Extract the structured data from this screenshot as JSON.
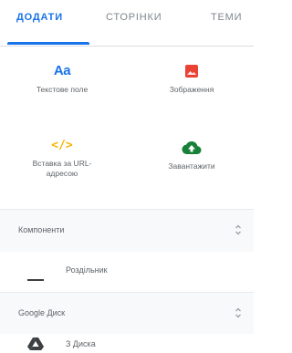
{
  "tabs": [
    {
      "label": "ДОДАТИ",
      "active": true
    },
    {
      "label": "СТОРІНКИ",
      "active": false
    },
    {
      "label": "ТЕМИ",
      "active": false
    }
  ],
  "insert_tiles": [
    {
      "label": "Текстове поле",
      "icon": "text-aa-icon"
    },
    {
      "label": "Зображення",
      "icon": "image-icon"
    },
    {
      "label": "Вставка за URL-адресою",
      "icon": "embed-code-icon"
    },
    {
      "label": "Завантажити",
      "icon": "cloud-upload-icon"
    }
  ],
  "icons": {
    "aa_text": "Aa",
    "code_text": "</>"
  },
  "sections": {
    "components": {
      "title": "Компоненти",
      "items": [
        {
          "label": "Роздільник",
          "icon": "divider-line-icon"
        }
      ]
    },
    "drive": {
      "title": "Google Диск",
      "items": [
        {
          "label": "З Диска",
          "icon": "google-drive-icon"
        }
      ]
    }
  },
  "colors": {
    "accent": "#1a73e8",
    "image_red": "#ea4335",
    "code_yellow": "#f6b400",
    "upload_green": "#188038",
    "text_gray": "#5f6368"
  }
}
